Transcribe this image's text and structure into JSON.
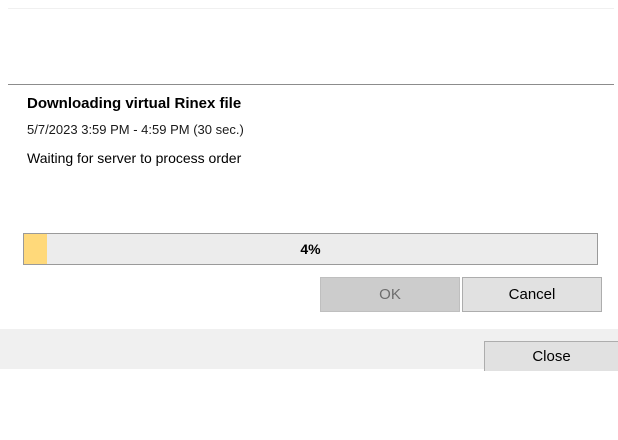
{
  "dialog": {
    "title": "Downloading virtual Rinex file",
    "time_range": "5/7/2023 3:59 PM - 4:59 PM (30 sec.)",
    "status": "Waiting for server to process order"
  },
  "progress": {
    "percent": 4,
    "label": "4%",
    "fill_color": "#ffd97a"
  },
  "buttons": {
    "ok_label": "OK",
    "cancel_label": "Cancel",
    "close_label": "Close"
  }
}
